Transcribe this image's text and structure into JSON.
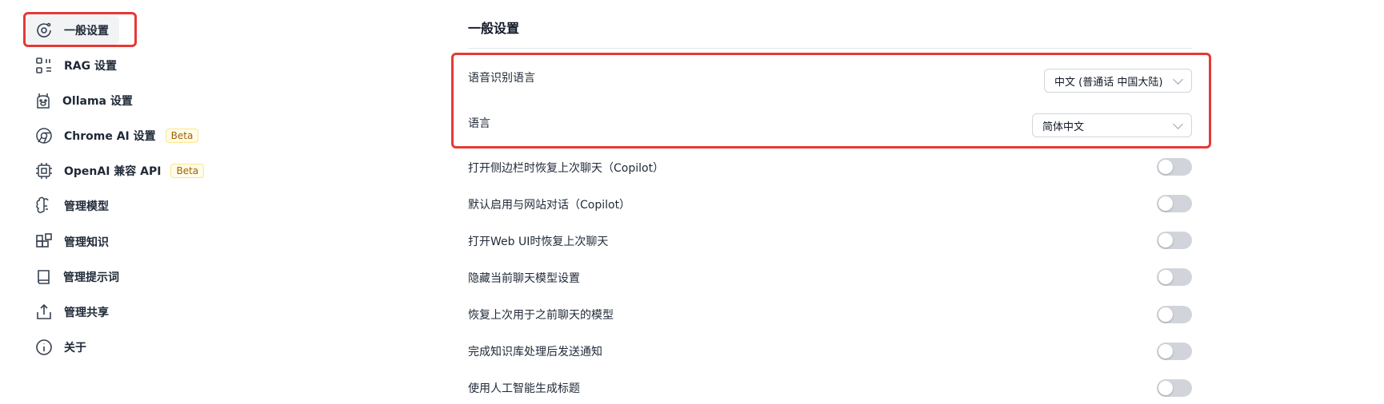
{
  "sidebar": {
    "items": [
      {
        "label": "一般设置",
        "icon": "general-settings-icon"
      },
      {
        "label": "RAG 设置",
        "icon": "rag-icon"
      },
      {
        "label": "Ollama 设置",
        "icon": "ollama-icon"
      },
      {
        "label": "Chrome AI 设置",
        "icon": "chrome-icon",
        "badge": "Beta"
      },
      {
        "label": "OpenAI 兼容 API",
        "icon": "chip-icon",
        "badge": "Beta"
      },
      {
        "label": "管理模型",
        "icon": "brain-icon"
      },
      {
        "label": "管理知识",
        "icon": "blocks-icon"
      },
      {
        "label": "管理提示词",
        "icon": "book-icon"
      },
      {
        "label": "管理共享",
        "icon": "share-icon"
      },
      {
        "label": "关于",
        "icon": "info-icon"
      }
    ]
  },
  "main": {
    "title": "一般设置",
    "speech_language": {
      "label": "语音识别语言",
      "value": "中文 (普通话 中国大陆)"
    },
    "language": {
      "label": "语言",
      "value": "简体中文"
    },
    "toggles": [
      {
        "label": "打开侧边栏时恢复上次聊天（Copilot）",
        "on": false
      },
      {
        "label": "默认启用与网站对话（Copilot）",
        "on": false
      },
      {
        "label": "打开Web UI时恢复上次聊天",
        "on": false
      },
      {
        "label": "隐藏当前聊天模型设置",
        "on": false
      },
      {
        "label": "恢复上次用于之前聊天的模型",
        "on": false
      },
      {
        "label": "完成知识库处理后发送通知",
        "on": false
      },
      {
        "label": "使用人工智能生成标题",
        "on": false
      }
    ]
  },
  "colors": {
    "highlight": "#e53935",
    "toggle_off": "#d1d5db",
    "badge_text": "#a16207",
    "badge_bg": "#fefce8"
  }
}
